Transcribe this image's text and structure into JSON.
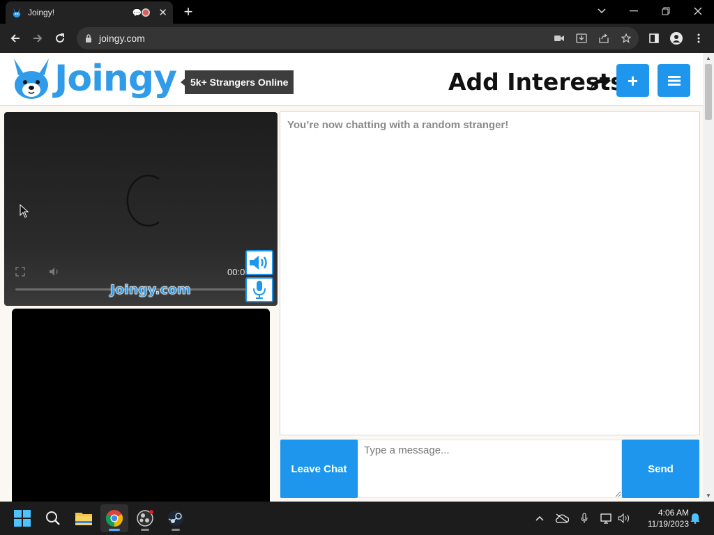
{
  "browser": {
    "tab_title": "Joingy!",
    "url": "joingy.com",
    "icons": [
      "camera-icon",
      "install-icon",
      "share-icon",
      "star-icon",
      "sidebar-icon",
      "profile-icon",
      "menu-icon"
    ]
  },
  "header": {
    "logo_text": "Joingy",
    "online_badge": "5k+ Strangers Online",
    "add_interests": "Add Interests",
    "plus_label": "+",
    "menu_label": "≡"
  },
  "video": {
    "time": "00:0",
    "watermark": "Joingy.com"
  },
  "chat": {
    "status_message": "You’re now chatting with a random stranger!",
    "leave_label": "Leave Chat",
    "input_placeholder": "Type a message...",
    "send_label": "Send"
  },
  "taskbar": {
    "apps": [
      "windows-start",
      "search",
      "file-explorer",
      "chrome",
      "obs",
      "steam"
    ],
    "time": "4:06 AM",
    "date": "11/19/2023"
  },
  "colors": {
    "accent": "#1f96ee",
    "logo": "#2f9be9",
    "badge_bg": "#3d3d3d",
    "page_bg": "#fbf8f3"
  }
}
